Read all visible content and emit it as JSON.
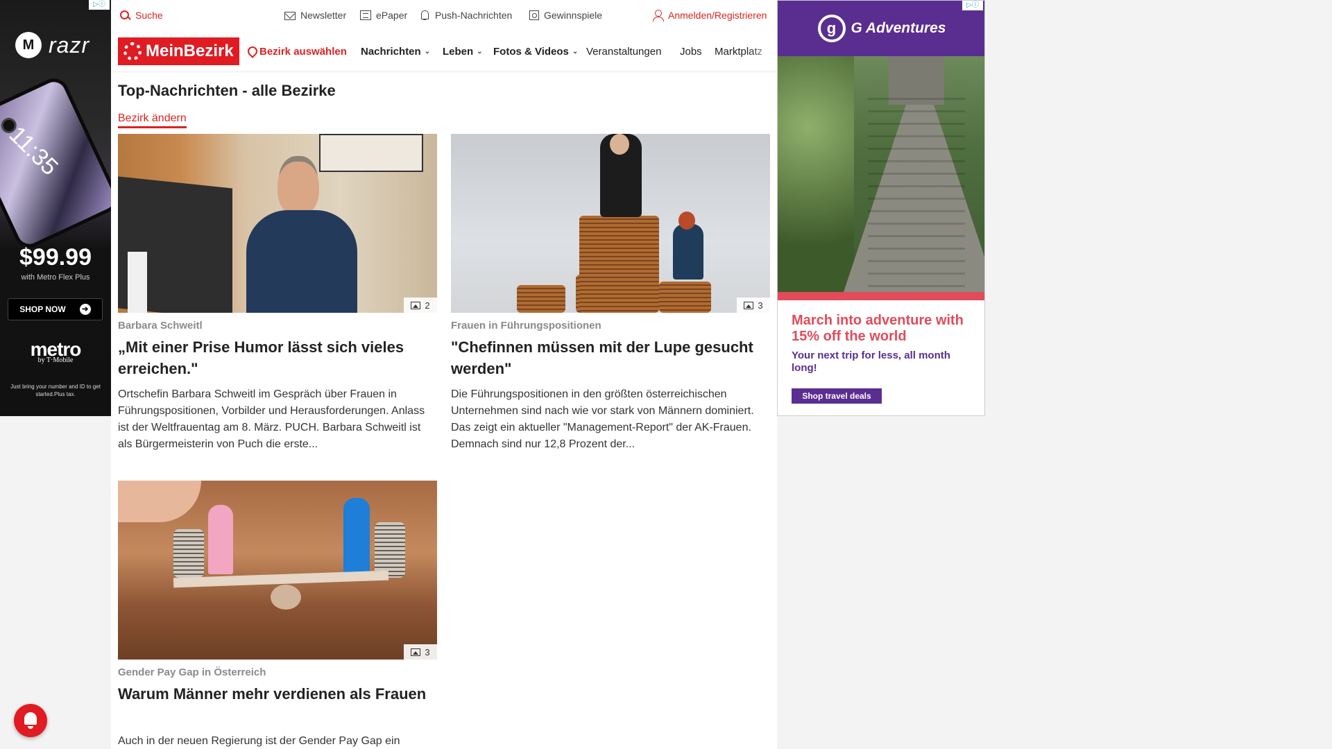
{
  "left_ad": {
    "adchoice": "▷ⓘ",
    "brand": "razr",
    "phone_time": "11:35",
    "price": "$99.99",
    "price_sub": "with Metro Flex Plus",
    "cta": "SHOP NOW",
    "carrier": "metro",
    "carrier_sub": "by T·Mobile",
    "fine_print": "Just bring your number and ID to get started.Plus tax."
  },
  "topbar": {
    "search": "Suche",
    "newsletter": "Newsletter",
    "epaper": "ePaper",
    "push": "Push-Nachrichten",
    "gewinnspiele": "Gewinnspiele",
    "login": "Anmelden/Registrieren"
  },
  "nav": {
    "logo": "MeinBezirk",
    "bezirk": "Bezirk auswählen",
    "items": [
      "Nachrichten",
      "Leben",
      "Fotos & Videos",
      "Veranstaltungen",
      "Jobs",
      "Marktplatz"
    ],
    "chevron": "⌄"
  },
  "section": {
    "title": "Top-Nachrichten - alle Bezirke",
    "change_link": "Bezirk ändern"
  },
  "articles": [
    {
      "kicker": "Barbara Schweitl",
      "headline": "„Mit einer Prise Humor lässt sich vieles erreichen.\"",
      "teaser": "Ortschefin Barbara Schweitl im Gespräch über Frauen in Führungspositionen, Vorbilder und Herausforderungen. Anlass ist der Weltfrauentag am 8. März.  PUCH. Barbara Schweitl ist als Bürgermeisterin von Puch die erste...",
      "photo_count": "2"
    },
    {
      "kicker": "Frauen in Führungspositionen",
      "headline": "\"Chefinnen müssen mit der Lupe gesucht werden\"",
      "teaser": "Die Führungspositionen in den größten österreichischen Unternehmen sind nach wie vor stark von Männern dominiert. Das zeigt ein aktueller \"Management-Report\" der AK-Frauen. Demnach sind nur 12,8 Prozent der...",
      "photo_count": "3"
    },
    {
      "kicker": "Gender Pay Gap in Österreich",
      "headline": "Warum Männer mehr verdienen als Frauen",
      "teaser": "Auch in der neuen Regierung ist der Gender Pay Gap ein",
      "photo_count": "3"
    }
  ],
  "right_ad": {
    "adchoice": "▷ⓘ",
    "brand_mark": "g",
    "brand": "G Adventures",
    "title": "March into adventure with 15% off the world",
    "subtitle": "Your next trip for less, all month long!",
    "cta": "Shop travel deals"
  }
}
